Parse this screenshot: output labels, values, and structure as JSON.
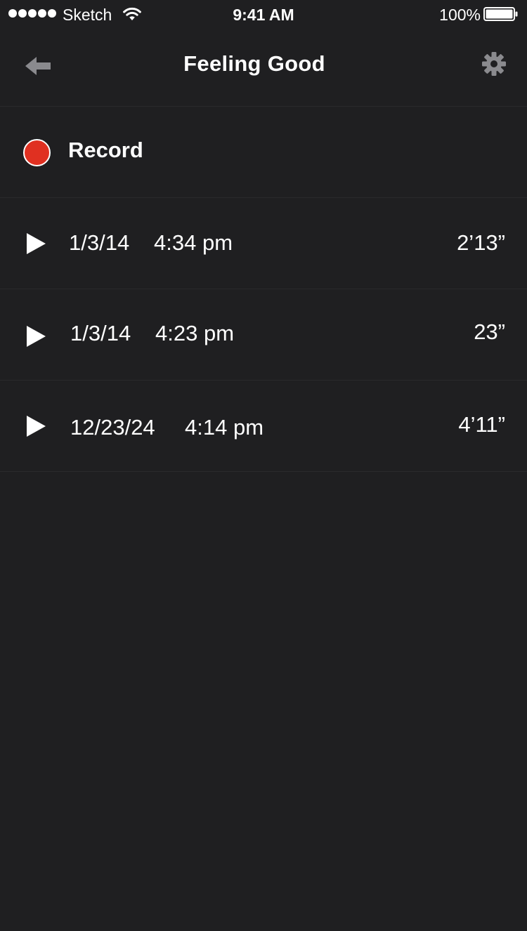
{
  "status_bar": {
    "carrier": "Sketch",
    "time": "9:41 AM",
    "battery_percent": "100%",
    "signal_icon": "signal-dots-icon",
    "wifi_icon": "wifi-icon",
    "battery_icon": "battery-icon"
  },
  "nav": {
    "title": "Feeling Good",
    "back_icon": "arrow-left-icon",
    "settings_icon": "gear-icon"
  },
  "record": {
    "label": "Record",
    "color": "#e03021"
  },
  "recordings": [
    {
      "date": "1/3/14",
      "time": "4:34 pm",
      "duration": "2’13”"
    },
    {
      "date": "1/3/14",
      "time": "4:23 pm",
      "duration": "23”"
    },
    {
      "date": "12/23/24",
      "time": "4:14 pm",
      "duration": "4’11”"
    }
  ],
  "colors": {
    "background": "#1f1f21",
    "divider": "#2a2a2c",
    "icon_gray": "#8a8a8e",
    "text": "#ffffff"
  }
}
